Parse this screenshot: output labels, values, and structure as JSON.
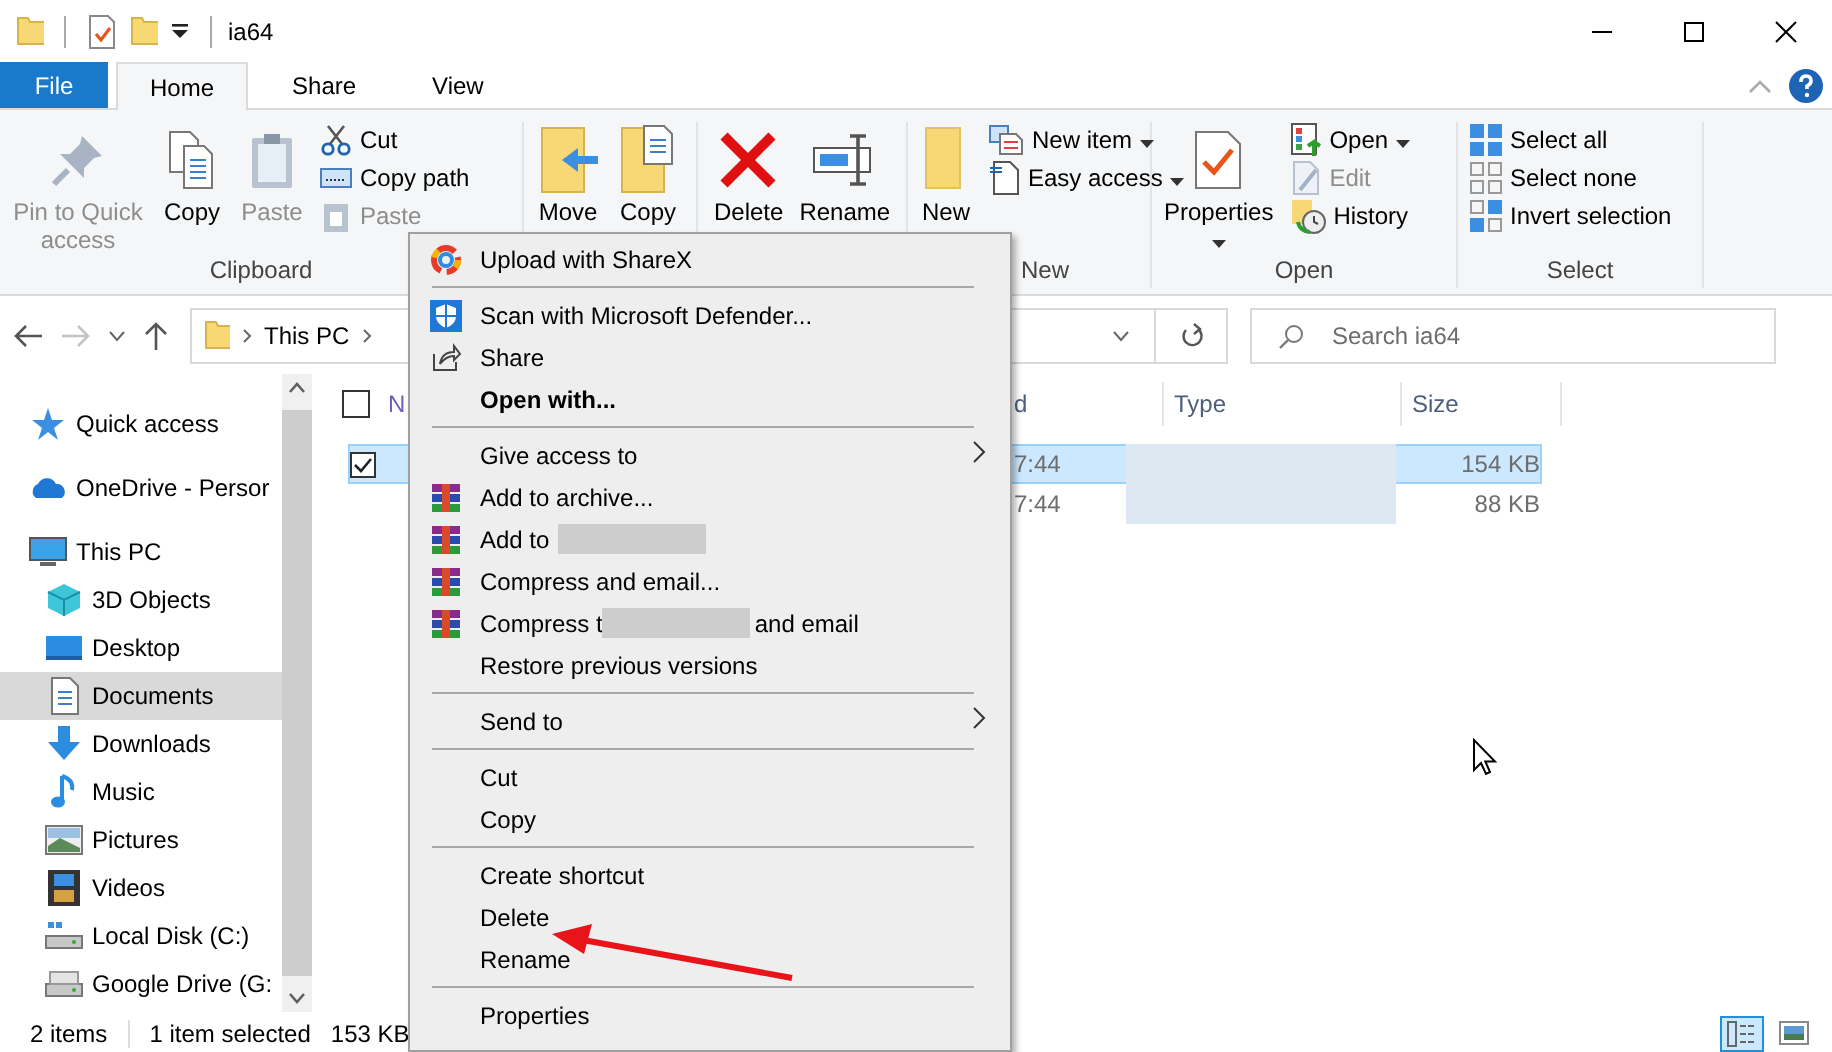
{
  "window": {
    "title": "ia64"
  },
  "ribbon": {
    "tabs": [
      {
        "label": "File",
        "kind": "file",
        "selected": false
      },
      {
        "label": "Home",
        "kind": "tab",
        "selected": true
      },
      {
        "label": "Share",
        "kind": "tab",
        "selected": false
      },
      {
        "label": "View",
        "kind": "tab",
        "selected": false
      }
    ],
    "groups": [
      {
        "label": "Clipboard",
        "commands": [
          {
            "label": "Pin to Quick access",
            "kind": "large",
            "disabled": true,
            "dropdown": false
          },
          {
            "label": "Copy",
            "kind": "large",
            "disabled": false,
            "dropdown": false
          },
          {
            "label": "Paste",
            "kind": "large",
            "disabled": true,
            "dropdown": false
          },
          {
            "label": "Cut",
            "kind": "small",
            "disabled": false,
            "dropdown": false
          },
          {
            "label": "Copy path",
            "kind": "small",
            "disabled": false,
            "dropdown": false
          },
          {
            "label": "Paste",
            "kind": "small",
            "disabled": true,
            "dropdown": false
          }
        ]
      },
      {
        "commands": [
          {
            "label": "Move",
            "kind": "large",
            "disabled": false,
            "dropdown": false
          },
          {
            "label": "Copy",
            "kind": "large",
            "disabled": false,
            "dropdown": false
          },
          {
            "label": "Delete",
            "kind": "large",
            "disabled": false,
            "dropdown": false
          },
          {
            "label": "Rename",
            "kind": "large",
            "disabled": false,
            "dropdown": false
          }
        ]
      },
      {
        "label": "New",
        "commands": [
          {
            "label": "New",
            "kind": "large",
            "disabled": false,
            "dropdown": false
          },
          {
            "label": "New item",
            "kind": "small",
            "disabled": false,
            "dropdown": true
          },
          {
            "label": "Easy access",
            "kind": "small",
            "disabled": false,
            "dropdown": true
          }
        ]
      },
      {
        "label": "Open",
        "commands": [
          {
            "label": "Properties",
            "kind": "large",
            "disabled": false,
            "dropdown": true
          },
          {
            "label": "Open",
            "kind": "small",
            "disabled": false,
            "dropdown": true
          },
          {
            "label": "Edit",
            "kind": "small",
            "disabled": true,
            "dropdown": false
          },
          {
            "label": "History",
            "kind": "small",
            "disabled": false,
            "dropdown": false
          }
        ]
      },
      {
        "label": "Select",
        "commands": [
          {
            "label": "Select all",
            "kind": "small",
            "disabled": false,
            "dropdown": false
          },
          {
            "label": "Select none",
            "kind": "small",
            "disabled": false,
            "dropdown": false
          },
          {
            "label": "Invert selection",
            "kind": "small",
            "disabled": false,
            "dropdown": false
          }
        ]
      }
    ]
  },
  "address_bar": {
    "path": [
      "This PC"
    ]
  },
  "search": {
    "placeholder": "Search ia64"
  },
  "navigation": [
    {
      "label": "Quick access",
      "selected": false
    },
    {
      "label": "OneDrive - Persor",
      "selected": false
    },
    {
      "label": "This PC",
      "selected": false,
      "children": [
        {
          "label": "3D Objects",
          "selected": false
        },
        {
          "label": "Desktop",
          "selected": false
        },
        {
          "label": "Documents",
          "selected": true
        },
        {
          "label": "Downloads",
          "selected": false
        },
        {
          "label": "Music",
          "selected": false
        },
        {
          "label": "Pictures",
          "selected": false
        },
        {
          "label": "Videos",
          "selected": false
        },
        {
          "label": "Local Disk (C:)",
          "selected": false
        },
        {
          "label": "Google Drive (G:",
          "selected": false
        }
      ]
    }
  ],
  "file_list": {
    "select_all_checked": false,
    "columns": [
      "N",
      "d",
      "Type",
      "Size"
    ],
    "rows": [
      {
        "selected": true,
        "checked": true,
        "modified": "7:44",
        "type_redacted": true,
        "size": "154 KB"
      },
      {
        "selected": false,
        "checked": false,
        "modified": "7:44",
        "type_redacted": true,
        "size": "88 KB"
      }
    ]
  },
  "context_menu": [
    {
      "kind": "item",
      "label": "Upload with ShareX",
      "bold": false,
      "submenu": false
    },
    {
      "kind": "separator"
    },
    {
      "kind": "item",
      "label": "Scan with Microsoft Defender...",
      "bold": false,
      "submenu": false
    },
    {
      "kind": "item",
      "label": "Share",
      "bold": false,
      "submenu": false
    },
    {
      "kind": "item",
      "label": "Open with...",
      "bold": true,
      "submenu": false
    },
    {
      "kind": "separator"
    },
    {
      "kind": "item",
      "label": "Give access to",
      "bold": false,
      "submenu": true
    },
    {
      "kind": "item",
      "label": "Add to archive...",
      "bold": false,
      "submenu": false
    },
    {
      "kind": "item",
      "label": "Add to",
      "bold": false,
      "submenu": false,
      "redacted": true
    },
    {
      "kind": "item",
      "label": "Compress and email...",
      "bold": false,
      "submenu": false
    },
    {
      "kind": "item",
      "label": "Compress t",
      "bold": false,
      "submenu": false,
      "redacted": true,
      "label_after": "and email"
    },
    {
      "kind": "item",
      "label": "Restore previous versions",
      "bold": false,
      "submenu": false
    },
    {
      "kind": "separator"
    },
    {
      "kind": "item",
      "label": "Send to",
      "bold": false,
      "submenu": true
    },
    {
      "kind": "separator"
    },
    {
      "kind": "item",
      "label": "Cut",
      "bold": false,
      "submenu": false
    },
    {
      "kind": "item",
      "label": "Copy",
      "bold": false,
      "submenu": false
    },
    {
      "kind": "separator"
    },
    {
      "kind": "item",
      "label": "Create shortcut",
      "bold": false,
      "submenu": false
    },
    {
      "kind": "item",
      "label": "Delete",
      "bold": false,
      "submenu": false
    },
    {
      "kind": "item",
      "label": "Rename",
      "bold": false,
      "submenu": false
    },
    {
      "kind": "separator"
    },
    {
      "kind": "item",
      "label": "Properties",
      "bold": false,
      "submenu": false
    }
  ],
  "status_bar": {
    "items": [
      "2 items",
      "1 item selected",
      "153 KB"
    ],
    "views": [
      {
        "selected": true
      },
      {
        "selected": false
      }
    ]
  }
}
